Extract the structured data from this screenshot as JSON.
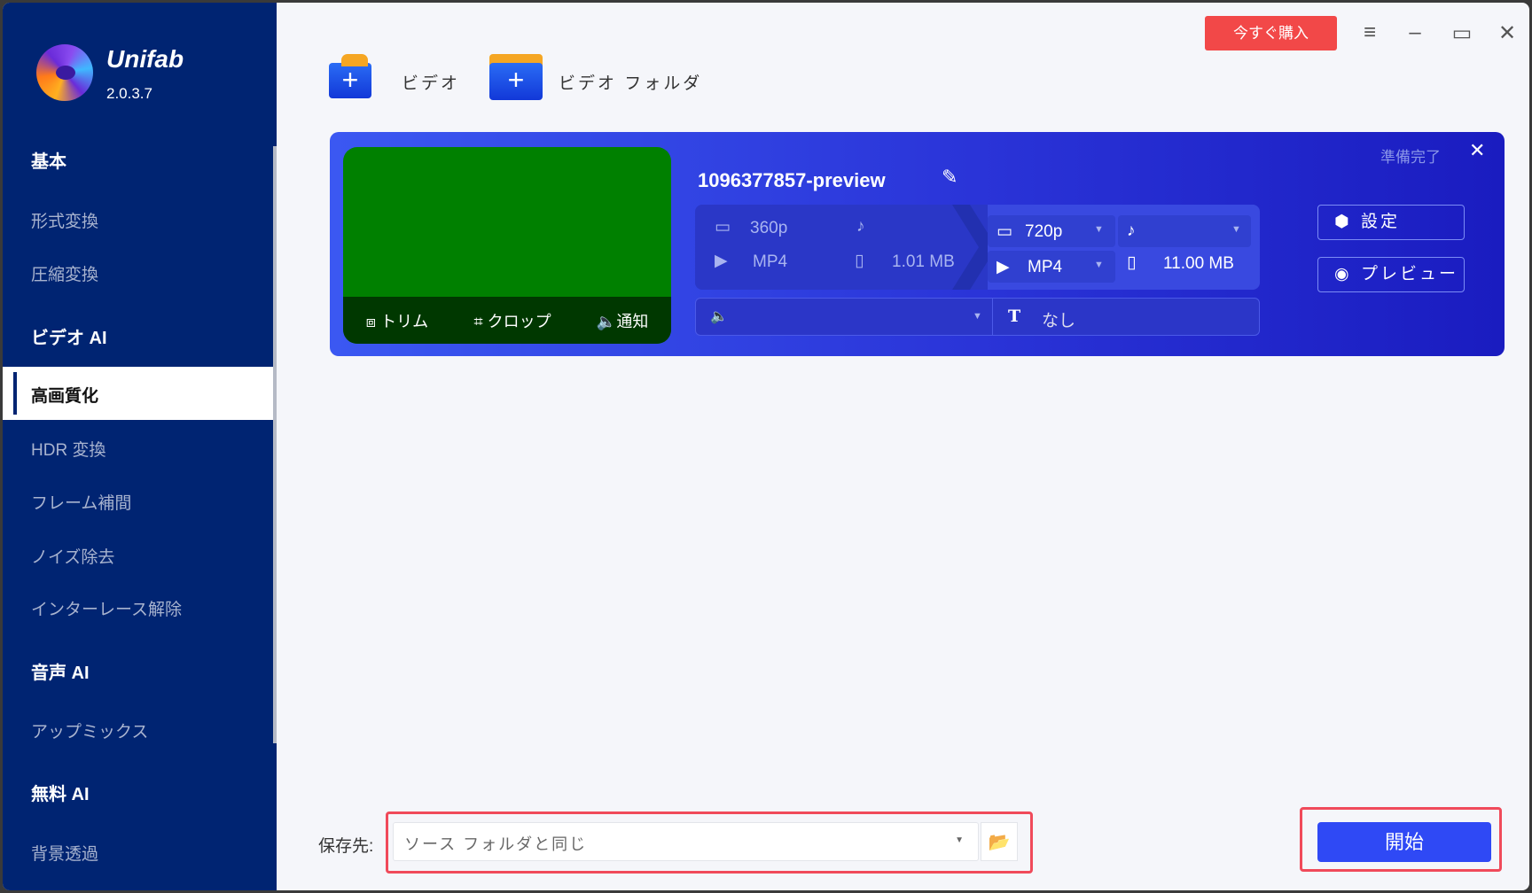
{
  "app": {
    "name": "Unifab",
    "version": "2.0.3.7"
  },
  "sidebar": {
    "sections": [
      {
        "title": "基本",
        "items": [
          "形式変換",
          "圧縮変換"
        ]
      },
      {
        "title": "ビデオ AI",
        "items": [
          "高画質化",
          "HDR 変換",
          "フレーム補間",
          "ノイズ除去",
          "インターレース解除"
        ]
      },
      {
        "title": "音声 AI",
        "items": [
          "アップミックス"
        ]
      },
      {
        "title": "無料 AI",
        "items": [
          "背景透過"
        ]
      }
    ],
    "active": "高画質化"
  },
  "titlebar": {
    "buy_label": "今すぐ購入"
  },
  "toolbar": {
    "add_video": "ビデオ",
    "add_folder": "ビデオ フォルダ"
  },
  "task": {
    "name": "1096377857-preview",
    "status": "準備完了",
    "thumb_actions": {
      "trim": "トリム",
      "crop": "クロップ",
      "notify": "通知"
    },
    "source": {
      "resolution": "360p",
      "format": "MP4",
      "size": "1.01 MB"
    },
    "output": {
      "resolution": "720p",
      "format": "MP4",
      "size": "11.00 MB"
    },
    "audio": "",
    "subtitle": "なし",
    "settings_label": "設定",
    "preview_label": "プレビュー"
  },
  "footer": {
    "save_label": "保存先:",
    "save_path": "ソース フォルダと同じ",
    "start_label": "開始"
  },
  "colors": {
    "sidebar": "#002472",
    "accent": "#2f49f5",
    "buy": "#f24848",
    "highlight": "#f04a5a"
  }
}
